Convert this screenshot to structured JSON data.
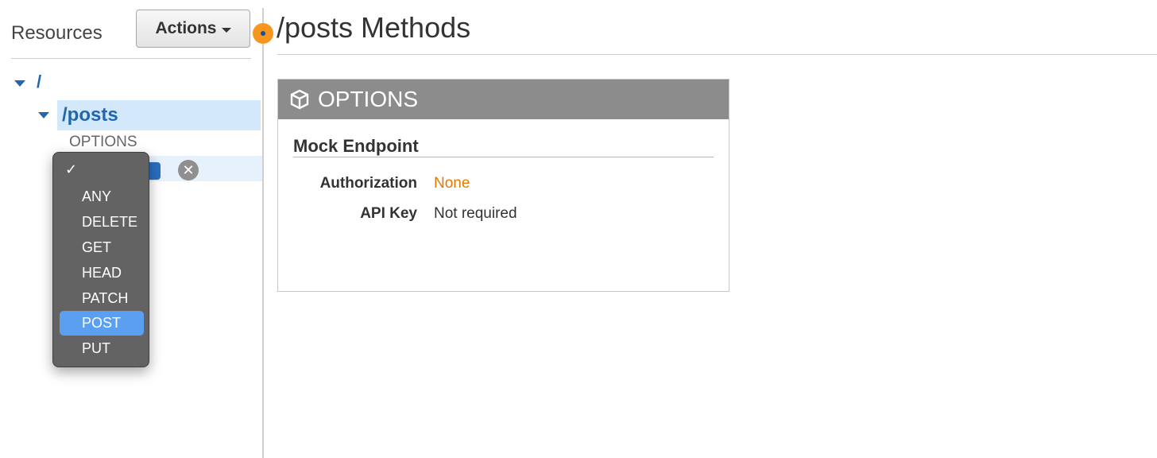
{
  "sidebar": {
    "title": "Resources",
    "actions_label": "Actions",
    "tree": {
      "root": "/",
      "posts": "/posts",
      "options": "OPTIONS"
    }
  },
  "method_dropdown": {
    "check": "✓",
    "options": [
      "ANY",
      "DELETE",
      "GET",
      "HEAD",
      "PATCH",
      "POST",
      "PUT"
    ],
    "selected": "POST"
  },
  "main": {
    "title": "/posts Methods",
    "card": {
      "method": "OPTIONS",
      "integration": "Mock Endpoint",
      "rows": [
        {
          "label": "Authorization",
          "value": "None"
        },
        {
          "label": "API Key",
          "value": "Not required"
        }
      ]
    }
  },
  "colors": {
    "link_blue": "#1f67b1",
    "selected_row": "#d4e8fb",
    "accent_orange": "#e07b00",
    "status_dot": "#f7961e",
    "menu_highlight": "#5b9ff1"
  },
  "icons": {
    "card_header": "cube-icon",
    "status": "status-dot-icon",
    "remove": "remove-circle-icon"
  }
}
